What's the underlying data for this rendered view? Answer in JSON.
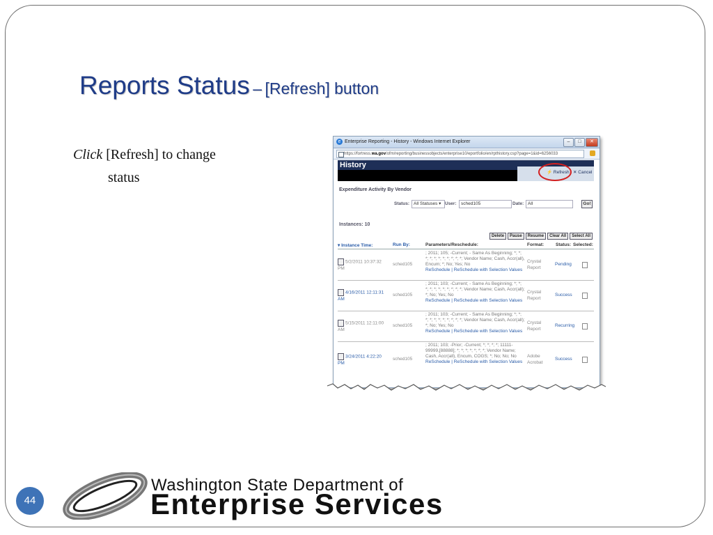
{
  "slide": {
    "title_main": "Reports Status",
    "title_sep": "–",
    "title_sub": "[Refresh] button",
    "body_click": "Click",
    "body_rest": " [Refresh] to change",
    "body_line2": "status",
    "page_number": "44"
  },
  "footer": {
    "line1": "Washington State Department of",
    "line2": "Enterprise Services"
  },
  "screenshot": {
    "window_title": "Enterprise Reporting - History - Windows Internet Explorer",
    "url_prefix": "https://fortress.",
    "url_domain": "wa.gov",
    "url_rest": "/ofm/reporting/businessobjects/enterprise10/eportfolio/en/rpthistory.csp?page=1&id=6256033",
    "history_title": "History",
    "refresh_label": "Refresh",
    "cancel_label": "Cancel",
    "report_name": "Expenditure Activity By Vendor",
    "filters": {
      "status_label": "Status:",
      "status_value": "All Statuses ▾",
      "user_label": "User:",
      "user_value": "sched105",
      "date_label": "Date:",
      "date_value": "All",
      "go_label": "Go!"
    },
    "instances_label": "Instances: 10",
    "actions": [
      "Delete",
      "Pause",
      "Resume",
      "Clear All",
      "Select All"
    ],
    "columns": {
      "instance_time": "▾ Instance Time:",
      "run_by": "Run By:",
      "params": "Parameters/Reschedule:",
      "format": "Format:",
      "status": "Status:",
      "selected": "Selected:"
    },
    "rows": [
      {
        "time": "5/2/2011 10:37:32 PM",
        "run_by": "sched105",
        "params": "; 2011; 105; -Current; - Same As Beginning; *; *; *; *; *; *; *; *; *; *; *; Vendor Name; Cash, Accr(all), Encum; *; No; Yes; No",
        "links": "ReSchedule | ReSchedule with Selection Values",
        "format": "Crystal Report",
        "status": "Pending"
      },
      {
        "time": "4/16/2011 12:11:31 AM",
        "run_by": "sched105",
        "params": "; 2011; 103; -Current; - Same As Beginning; *; *; *; *; *; *; *; *; *; *; *; Vendor Name; Cash, Accr(all); *; No; Yes; No",
        "links": "ReSchedule | ReSchedule with Selection Values",
        "format": "Crystal Report",
        "status": "Success"
      },
      {
        "time": "5/15/2011 12:11:00 AM",
        "run_by": "sched105",
        "params": "; 2011; 103; -Current; - Same As Beginning; *; *; *; *; *; *; *; *; *; *; *; Vendor Name; Cash, Accr(all); *; No; Yes; No",
        "links": "ReSchedule | ReSchedule with Selection Values",
        "format": "Crystal Report",
        "status": "Recurring"
      },
      {
        "time": "3/24/2011 4:22:20 PM",
        "run_by": "sched105",
        "params": "; 2011; 103; -Prior; -Current; *; *; *; *; 11111-99999,[88888]; *; *; *; *; *; *; *; Vendor Name; Cash, Accr(all), Encum, COGS; *; No; No; No",
        "links": "ReSchedule | ReSchedule with Selection Values",
        "format": "Adobe Acrobat",
        "status": "Success"
      }
    ]
  },
  "colors": {
    "title_blue": "#1f3c88",
    "badge_blue": "#3e73b7",
    "highlight_red": "#d42020",
    "header_navy": "#1e2f57"
  }
}
